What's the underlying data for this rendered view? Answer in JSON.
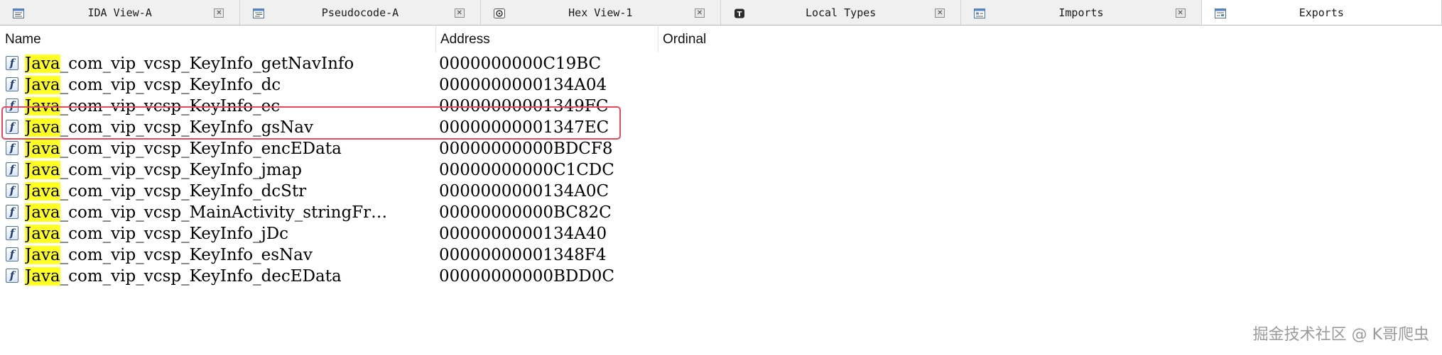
{
  "tabs": [
    {
      "label": "IDA View-A",
      "icon": "disassembly-view-icon",
      "active": false
    },
    {
      "label": "Pseudocode-A",
      "icon": "pseudocode-view-icon",
      "active": false
    },
    {
      "label": "Hex View-1",
      "icon": "hex-view-icon",
      "active": false
    },
    {
      "label": "Local Types",
      "icon": "local-types-icon",
      "active": false
    },
    {
      "label": "Imports",
      "icon": "imports-icon",
      "active": false
    },
    {
      "label": "Exports",
      "icon": "exports-icon",
      "active": true
    }
  ],
  "close_glyph": "✕",
  "columns": {
    "name": "Name",
    "address": "Address",
    "ordinal": "Ordinal"
  },
  "search_highlight": "Java",
  "function_icon_glyph": "f",
  "rows": [
    {
      "name_match": "Java",
      "name_rest": "_com_vip_vcsp_KeyInfo_getNavInfo",
      "address": "0000000000C19BC",
      "ordinal": ""
    },
    {
      "name_match": "Java",
      "name_rest": "_com_vip_vcsp_KeyInfo_dc",
      "address": "0000000000134A04",
      "ordinal": ""
    },
    {
      "name_match": "Java",
      "name_rest": "_com_vip_vcsp_KeyInfo_ec",
      "address": "00000000001349FC",
      "ordinal": ""
    },
    {
      "name_match": "Java",
      "name_rest": "_com_vip_vcsp_KeyInfo_gsNav",
      "address": "00000000001347EC",
      "ordinal": ""
    },
    {
      "name_match": "Java",
      "name_rest": "_com_vip_vcsp_KeyInfo_encEData",
      "address": "00000000000BDCF8",
      "ordinal": ""
    },
    {
      "name_match": "Java",
      "name_rest": "_com_vip_vcsp_KeyInfo_jmap",
      "address": "00000000000C1CDC",
      "ordinal": ""
    },
    {
      "name_match": "Java",
      "name_rest": "_com_vip_vcsp_KeyInfo_dcStr",
      "address": "0000000000134A0C",
      "ordinal": ""
    },
    {
      "name_match": "Java",
      "name_rest": "_com_vip_vcsp_MainActivity_stringFr…",
      "address": "00000000000BC82C",
      "ordinal": ""
    },
    {
      "name_match": "Java",
      "name_rest": "_com_vip_vcsp_KeyInfo_jDc",
      "address": "0000000000134A40",
      "ordinal": ""
    },
    {
      "name_match": "Java",
      "name_rest": "_com_vip_vcsp_KeyInfo_esNav",
      "address": "00000000001348F4",
      "ordinal": ""
    },
    {
      "name_match": "Java",
      "name_rest": "_com_vip_vcsp_KeyInfo_decEData",
      "address": "00000000000BDD0C",
      "ordinal": ""
    }
  ],
  "watermark": "掘金技术社区 @ K哥爬虫",
  "colors": {
    "highlight": "#ffff22",
    "annotation_box": "#e8485a"
  }
}
